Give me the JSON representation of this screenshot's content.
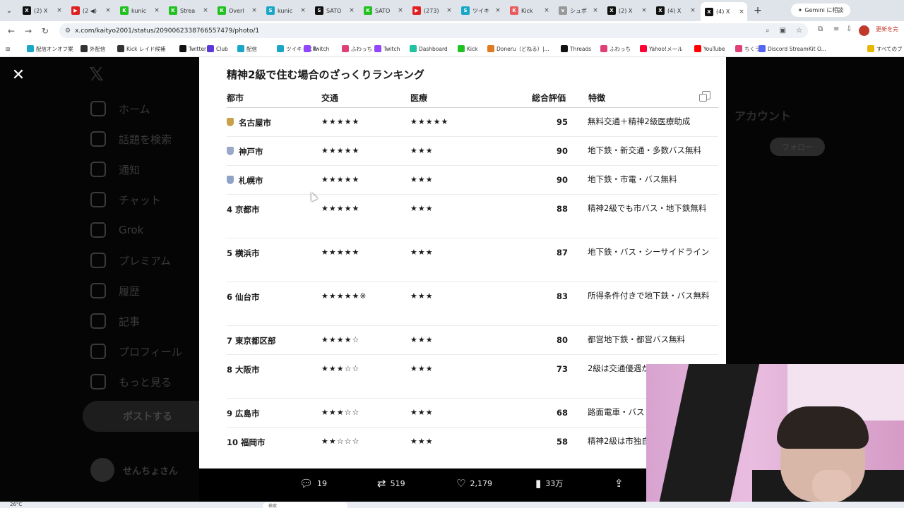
{
  "browser": {
    "tabs": [
      {
        "title": "(2) X",
        "color": "#111111",
        "glyph": "X"
      },
      {
        "title": "(2 ◀)",
        "color": "#e02020",
        "glyph": "▶"
      },
      {
        "title": "kunic",
        "color": "#22c122",
        "glyph": "K"
      },
      {
        "title": "Strea",
        "color": "#22c122",
        "glyph": "K"
      },
      {
        "title": "Overl",
        "color": "#22c122",
        "glyph": "K"
      },
      {
        "title": "kunic",
        "color": "#1aa7c7",
        "glyph": "S"
      },
      {
        "title": "SATO",
        "color": "#111111",
        "glyph": "S"
      },
      {
        "title": "SATO",
        "color": "#22c122",
        "glyph": "K"
      },
      {
        "title": "(273)",
        "color": "#e02020",
        "glyph": "▶"
      },
      {
        "title": "ツイキ",
        "color": "#1aa7c7",
        "glyph": "S"
      },
      {
        "title": "Kick",
        "color": "#e85c5c",
        "glyph": "K"
      },
      {
        "title": "シュポ",
        "color": "#999999",
        "glyph": "v"
      },
      {
        "title": "(2) X",
        "color": "#111111",
        "glyph": "X"
      },
      {
        "title": "(4) X",
        "color": "#111111",
        "glyph": "X"
      },
      {
        "title": "(4) X",
        "color": "#111111",
        "glyph": "X"
      }
    ],
    "active_tab": 14,
    "gemini_label": "Gemini に相談",
    "url": "x.com/kaityo2001/status/2090062338766557479/photo/1",
    "update_label": "更新を完",
    "bookmarks": [
      {
        "label": "配信オンオフ案",
        "color": "#1aa7c7"
      },
      {
        "label": "外配信",
        "color": "#333333"
      },
      {
        "label": "Kick レイド候補",
        "color": "#333333"
      },
      {
        "label": "Twitter",
        "color": "#111111"
      },
      {
        "label": "Club",
        "color": "#5b3bd8"
      },
      {
        "label": "配信",
        "color": "#1aa7c7"
      },
      {
        "label": "ツイキャスR",
        "color": "#1aa7c7"
      },
      {
        "label": "Twitch",
        "color": "#9146ff"
      },
      {
        "label": "ふわっち",
        "color": "#e0407a"
      },
      {
        "label": "Twitch",
        "color": "#9146ff"
      },
      {
        "label": "Dashboard",
        "color": "#22c1a0"
      },
      {
        "label": "Kick",
        "color": "#22c122"
      },
      {
        "label": "Doneru（どねる）|...",
        "color": "#e07a20"
      },
      {
        "label": "Threads",
        "color": "#111111"
      },
      {
        "label": "ふわっち",
        "color": "#e0407a"
      },
      {
        "label": "Yahoo!メール",
        "color": "#ff0033"
      },
      {
        "label": "YouTube",
        "color": "#ff0000"
      },
      {
        "label": "ちくラン",
        "color": "#e0407a"
      },
      {
        "label": "Discord StreamKit O...",
        "color": "#5865f2"
      },
      {
        "label": "すべてのブ",
        "color": "#e6b800"
      }
    ]
  },
  "x_app": {
    "nav": [
      "ホーム",
      "話題を検索",
      "通知",
      "チャット",
      "Grok",
      "プレミアム",
      "履歴",
      "記事",
      "プロフィール",
      "もっと見る"
    ],
    "post_label": "ポストする",
    "user_name": "せんちょさん",
    "right_heading": "アカウント",
    "follow_label": "フォロー"
  },
  "photo": {
    "title": "精神2級で住む場合のざっくりランキング",
    "headers": {
      "city": "都市",
      "transport": "交通",
      "medical": "医療",
      "total": "総合評価",
      "features": "特徴"
    },
    "rows": [
      {
        "rank": "",
        "medal": "#c9a14a",
        "city": "名古屋市",
        "transport": "★★★★★",
        "medical": "★★★★★",
        "total": "95",
        "features": "無料交通＋精神2級医療助成"
      },
      {
        "rank": "",
        "medal": "#9aa7c9",
        "city": "神戸市",
        "transport": "★★★★★",
        "medical": "★★★",
        "total": "90",
        "features": "地下鉄・新交通・多数バス無料"
      },
      {
        "rank": "",
        "medal": "#8fa3c7",
        "city": "札幌市",
        "transport": "★★★★★",
        "medical": "★★★",
        "total": "90",
        "features": "地下鉄・市電・バス無料"
      },
      {
        "rank": "4",
        "medal": "",
        "city": "京都市",
        "transport": "★★★★★",
        "medical": "★★★",
        "total": "88",
        "features": "精神2級でも市バス・地下鉄無料"
      },
      {
        "rank": "5",
        "medal": "",
        "city": "横浜市",
        "transport": "★★★★★",
        "medical": "★★★",
        "total": "87",
        "features": "地下鉄・バス・シーサイドライン"
      },
      {
        "rank": "6",
        "medal": "",
        "city": "仙台市",
        "transport": "★★★★★※",
        "medical": "★★★",
        "total": "83",
        "features": "所得条件付きで地下鉄・バス無料"
      },
      {
        "rank": "7",
        "medal": "",
        "city": "東京都区部",
        "transport": "★★★★☆",
        "medical": "★★★",
        "total": "80",
        "features": "都営地下鉄・都営バス無料"
      },
      {
        "rank": "8",
        "medal": "",
        "city": "大阪市",
        "transport": "★★★☆☆",
        "medical": "★★★",
        "total": "73",
        "features": "2級は交通優遇が弱い"
      },
      {
        "rank": "9",
        "medal": "",
        "city": "広島市",
        "transport": "★★★☆☆",
        "medical": "★★★",
        "total": "68",
        "features": "路面電車・バス"
      },
      {
        "rank": "10",
        "medal": "",
        "city": "福岡市",
        "transport": "★★☆☆☆",
        "medical": "★★★",
        "total": "58",
        "features": "精神2級は市独自の対象外"
      }
    ]
  },
  "actions": {
    "reply": "19",
    "repost": "519",
    "like": "2,179",
    "views": "33万"
  },
  "taskbar": {
    "weather": "26°C",
    "search": "検索"
  }
}
